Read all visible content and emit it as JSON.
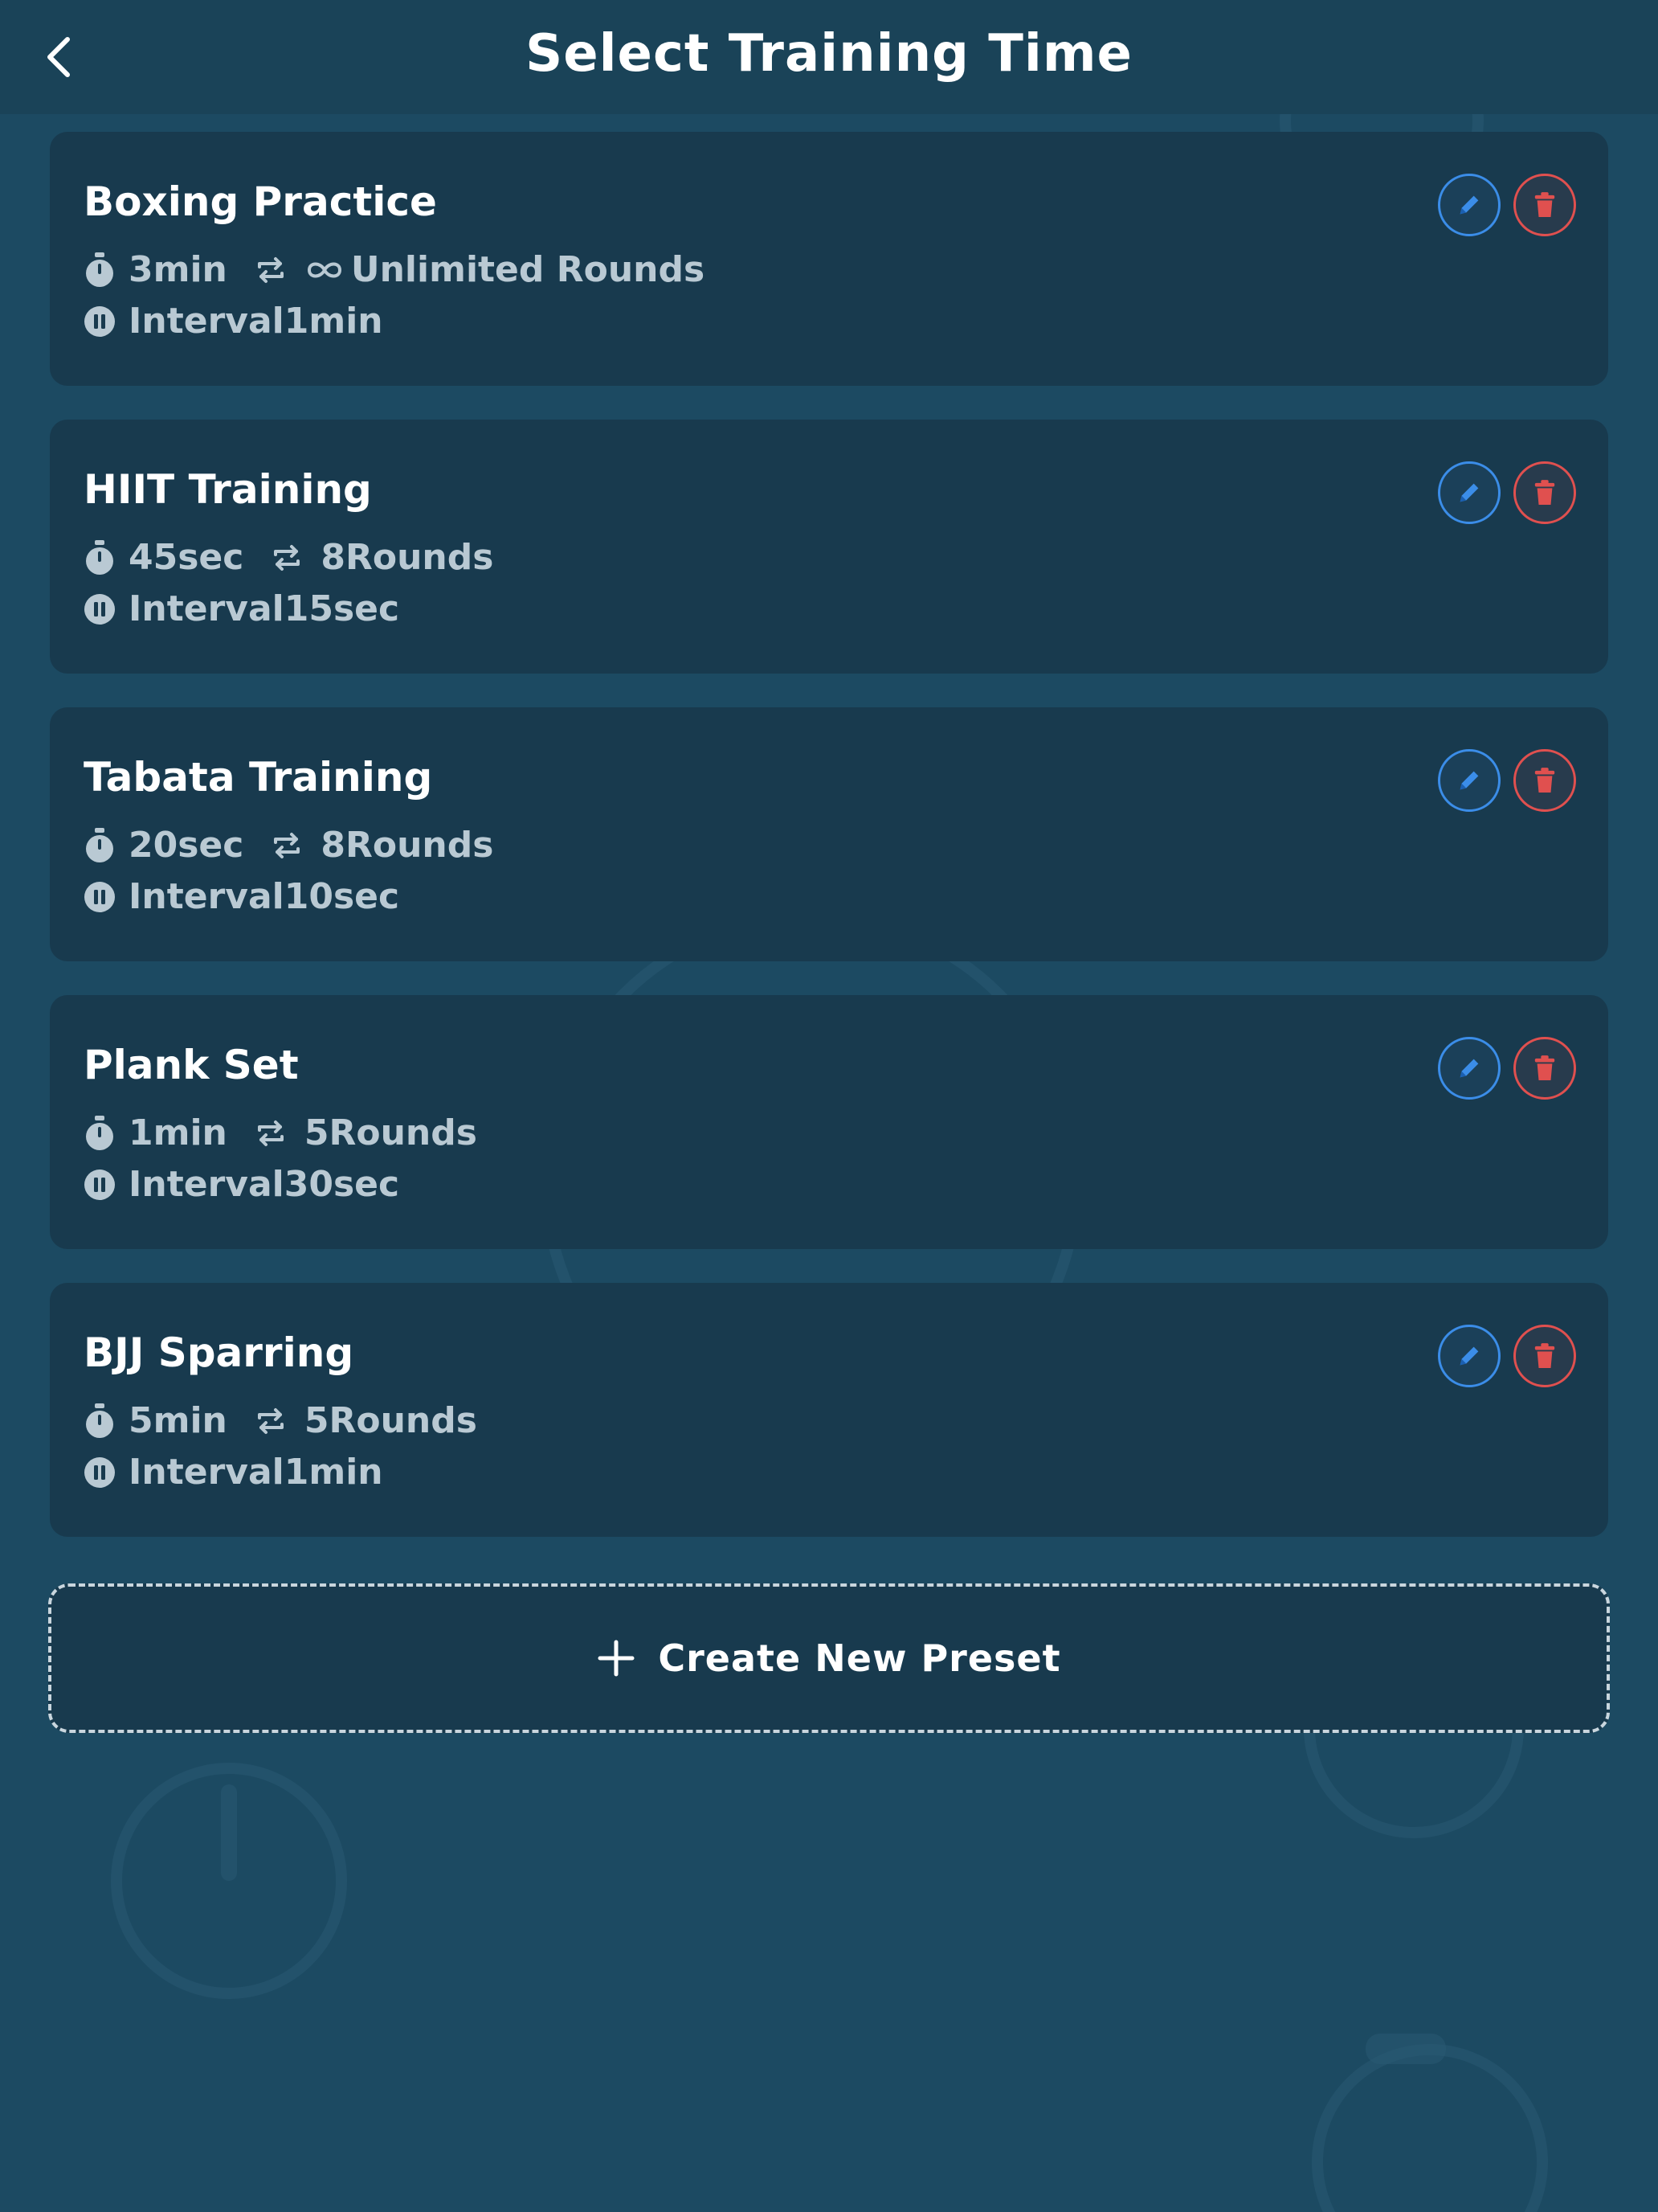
{
  "header": {
    "title": "Select Training Time",
    "back_icon": "chevron-left-icon"
  },
  "presets": [
    {
      "name": "Boxing Practice",
      "duration": "3min",
      "rounds": "Unlimited Rounds",
      "unlimited": true,
      "interval": "Interval1min"
    },
    {
      "name": "HIIT Training",
      "duration": "45sec",
      "rounds": "8Rounds",
      "unlimited": false,
      "interval": "Interval15sec"
    },
    {
      "name": "Tabata Training",
      "duration": "20sec",
      "rounds": "8Rounds",
      "unlimited": false,
      "interval": "Interval10sec"
    },
    {
      "name": "Plank Set",
      "duration": "1min",
      "rounds": "5Rounds",
      "unlimited": false,
      "interval": "Interval30sec"
    },
    {
      "name": "BJJ Sparring",
      "duration": "5min",
      "rounds": "5Rounds",
      "unlimited": false,
      "interval": "Interval1min"
    }
  ],
  "create_button": {
    "label": "Create New Preset",
    "icon": "plus-icon"
  },
  "colors": {
    "background": "#1c4a62",
    "card": "#183a4e",
    "edit_accent": "#3b8de8",
    "delete_accent": "#e0504f",
    "meta_text": "#b9c9d3"
  }
}
